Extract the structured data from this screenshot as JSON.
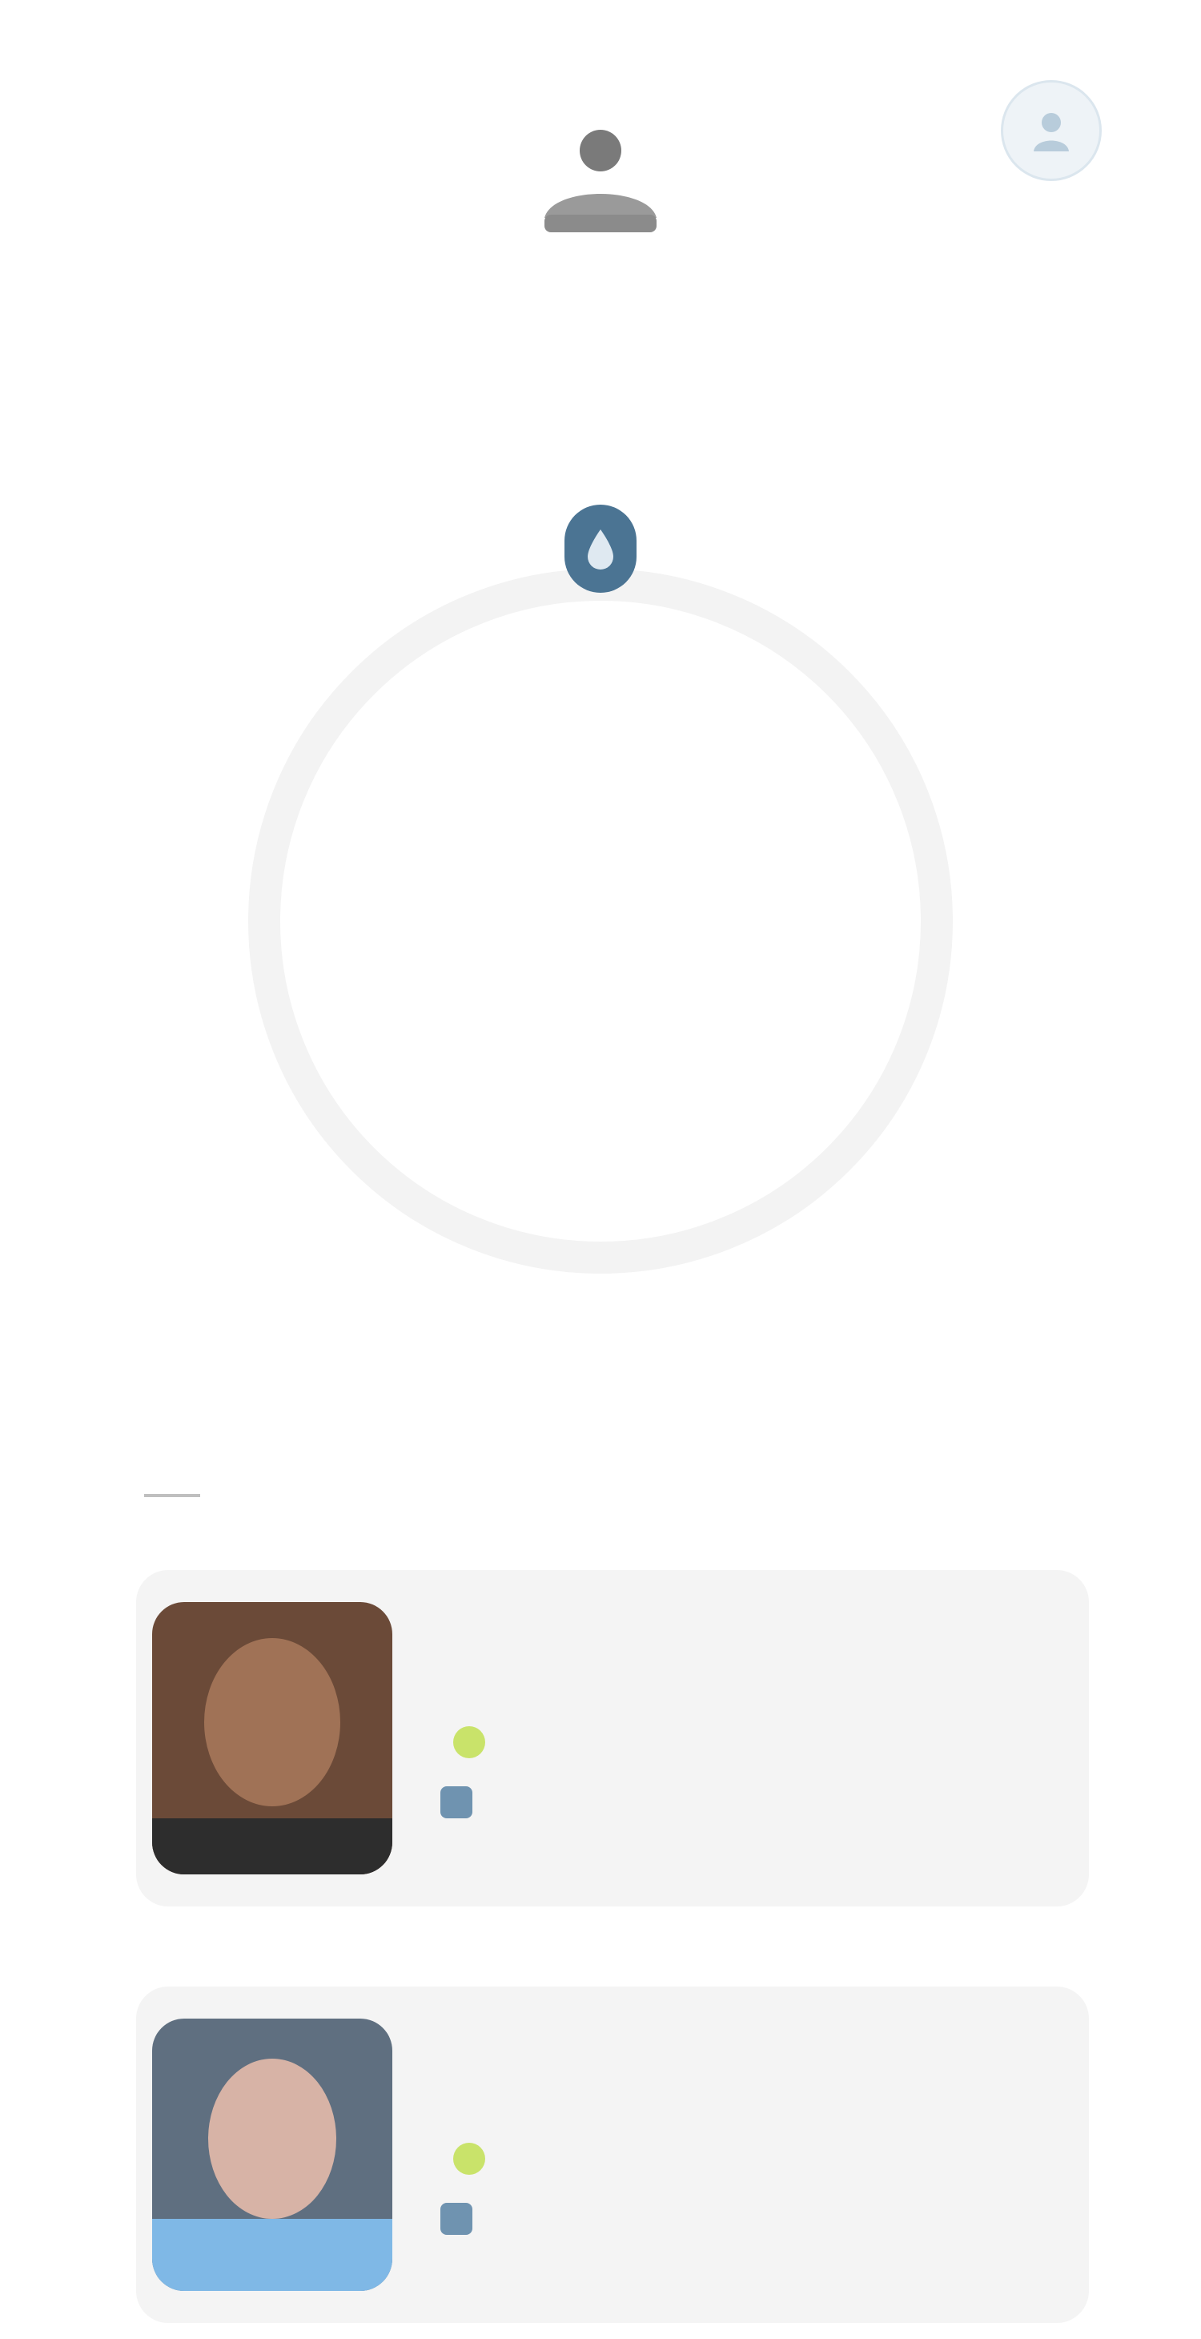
{
  "header": {
    "lang_label": "",
    "logo_icon": "user-silhouette-icon",
    "account_icon": "person-icon"
  },
  "intro": {
    "headline_text": "",
    "headline_accent": "",
    "subline": ""
  },
  "ring_widget": {
    "icon": "drop-icon",
    "value": "",
    "label": "",
    "sublabel": "",
    "accent_color": "#3f7399"
  },
  "primary_link": {
    "label": ""
  },
  "section": {
    "title": ""
  },
  "cards": [
    {
      "name": "",
      "description": "",
      "meta": "",
      "footer": "",
      "status_color": "#c9e36a"
    },
    {
      "name": "",
      "description": "",
      "meta": "",
      "footer": "",
      "status_color": "#c9e36a"
    }
  ]
}
